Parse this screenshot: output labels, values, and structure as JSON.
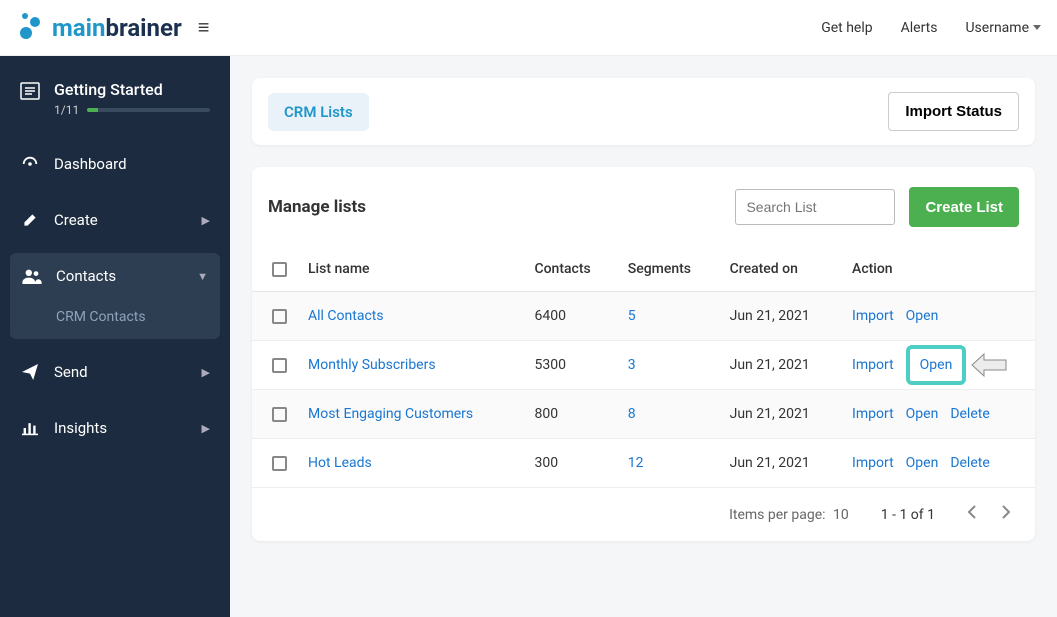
{
  "topbar": {
    "logo_main": "main",
    "logo_brainer": "brainer",
    "help": "Get help",
    "alerts": "Alerts",
    "username": "Username"
  },
  "sidebar": {
    "gs": {
      "title": "Getting Started",
      "progress": "1/11"
    },
    "items": [
      {
        "label": "Dashboard",
        "has_chevron": false
      },
      {
        "label": "Create",
        "has_chevron": true
      },
      {
        "label": "Contacts",
        "has_chevron": true,
        "expanded": true
      },
      {
        "label": "Send",
        "has_chevron": true
      },
      {
        "label": "Insights",
        "has_chevron": true
      }
    ],
    "sub_contacts": "CRM Contacts"
  },
  "tabs": {
    "crm_lists": "CRM Lists",
    "import_status": "Import Status"
  },
  "table": {
    "title": "Manage lists",
    "search_placeholder": "Search List",
    "create_btn": "Create List",
    "headers": {
      "list_name": "List name",
      "contacts": "Contacts",
      "segments": "Segments",
      "created_on": "Created on",
      "action": "Action"
    },
    "rows": [
      {
        "name": "All Contacts",
        "contacts": "6400",
        "segments": "5",
        "created": "Jun 21, 2021",
        "actions": [
          "Import",
          "Open"
        ],
        "highlight_open": false
      },
      {
        "name": "Monthly Subscribers",
        "contacts": "5300",
        "segments": "3",
        "created": "Jun 21, 2021",
        "actions": [
          "Import",
          "Open"
        ],
        "highlight_open": true
      },
      {
        "name": "Most Engaging Customers",
        "contacts": "800",
        "segments": "8",
        "created": "Jun 21, 2021",
        "actions": [
          "Import",
          "Open",
          "Delete"
        ],
        "highlight_open": false
      },
      {
        "name": "Hot Leads",
        "contacts": "300",
        "segments": "12",
        "created": "Jun 21, 2021",
        "actions": [
          "Import",
          "Open",
          "Delete"
        ],
        "highlight_open": false
      }
    ]
  },
  "pagination": {
    "items_per_page_label": "Items per page:",
    "items_per_page": "10",
    "range": "1 - 1 of 1"
  }
}
